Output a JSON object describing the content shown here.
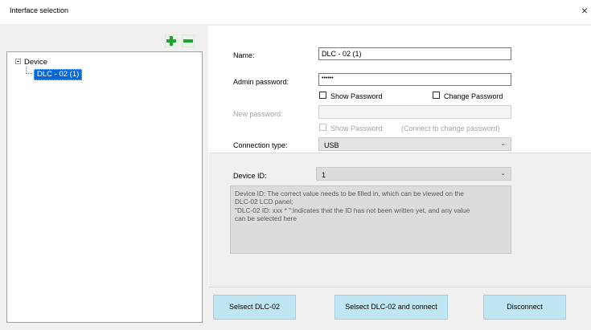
{
  "window": {
    "title": "Interface selection",
    "close_glyph": "×"
  },
  "tree": {
    "root_label": "Device",
    "selected_child": "DLC - 02 (1)"
  },
  "toolbar": {
    "add_icon": "plus-icon",
    "remove_icon": "minus-icon",
    "add_color": "#1fa22e",
    "remove_color": "#1fa22e"
  },
  "form": {
    "name_label": "Name:",
    "name_value": "DLC - 02 (1)",
    "admin_password_label": "Admin password:",
    "admin_password_value": "••••••",
    "show_password_label": "Show Password",
    "change_password_label": "Change Password",
    "new_password_label": "New password:",
    "new_password_value": "",
    "show_password2_label": "Show Password",
    "connect_hint": "(Connect to change password)",
    "connection_type_label": "Connection type:",
    "connection_type_value": "USB"
  },
  "device": {
    "id_label": "Device ID:",
    "id_value": "1",
    "desc_lines": [
      "Device ID: The correct value needs to be filled in, which can be viewed on the",
      "DLC-02 LCD panel;",
      "\"DLC-02 ID: xxx * \":indicates that the ID has not been written yet, and any value",
      "can be selected here"
    ]
  },
  "buttons": {
    "select": "Selsect DLC-02",
    "select_connect": "Selsect DLC-02 and connect",
    "disconnect": "Disconnect",
    "accent": "#bfe6f2"
  }
}
